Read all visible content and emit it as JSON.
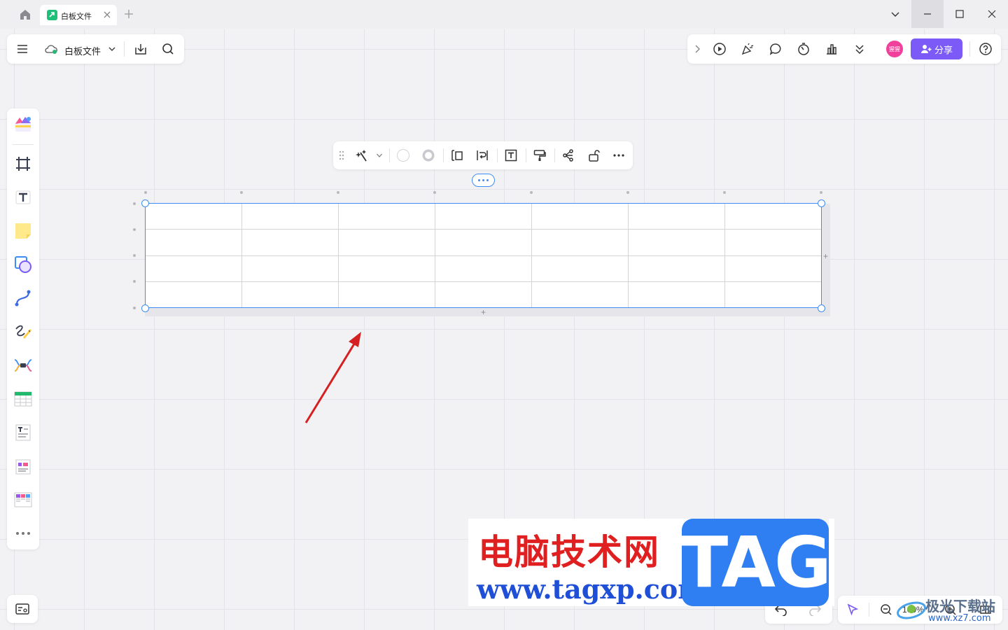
{
  "titlebar": {
    "tab_title": "白板文件",
    "add_tab": "+",
    "buttons": [
      "chevron-down-icon",
      "minimize-icon",
      "maximize-icon",
      "close-icon"
    ]
  },
  "file_toolbar": {
    "file_name": "白板文件",
    "icons": [
      "menu-icon",
      "cloud-saved-icon",
      "chevron-down-icon",
      "download-icon",
      "search-icon"
    ]
  },
  "top_right_toolbar": {
    "avatar_text": "猩猩",
    "share_label": "分享",
    "icons": [
      "expand-icon",
      "play-icon",
      "celebrate-icon",
      "comment-icon",
      "timer-icon",
      "vote-icon",
      "more-down-icon",
      "help-icon"
    ]
  },
  "left_toolbar": {
    "items": [
      "templates-icon",
      "frame-icon",
      "text-icon",
      "sticky-note-icon",
      "shape-icon",
      "connector-icon",
      "pen-icon",
      "mindmap-icon",
      "table-icon",
      "doc-icon",
      "card-icon",
      "kanban-icon",
      "more-icon"
    ]
  },
  "context_toolbar": {
    "icons": [
      "drag-handle-icon",
      "magic-icon",
      "chevron-down-icon",
      "fill-color-icon",
      "border-color-icon",
      "row-height-icon",
      "text-wrap-icon",
      "text-box-icon",
      "format-painter-icon",
      "link-icon",
      "lock-icon",
      "more-icon"
    ]
  },
  "table": {
    "rows": 4,
    "columns": 7,
    "cells": [
      [
        "",
        "",
        "",
        "",
        "",
        "",
        ""
      ],
      [
        "",
        "",
        "",
        "",
        "",
        "",
        ""
      ],
      [
        "",
        "",
        "",
        "",
        "",
        "",
        ""
      ],
      [
        "",
        "",
        "",
        "",
        "",
        "",
        ""
      ]
    ]
  },
  "bottom": {
    "zoom": "100%",
    "icons": [
      "minimap-icon",
      "undo-icon",
      "redo-icon",
      "select-icon",
      "zoom-out-icon",
      "zoom-in-icon",
      "fit-icon"
    ]
  },
  "watermark": {
    "cn": "电脑技术网",
    "url": "www.tagxp.com",
    "tag": "TAG",
    "cn2": "极光下载站",
    "url2": "www.xz7.com"
  },
  "colors": {
    "accent": "#3d8df5",
    "share": "#7b5af7",
    "arrow": "#d42020"
  }
}
